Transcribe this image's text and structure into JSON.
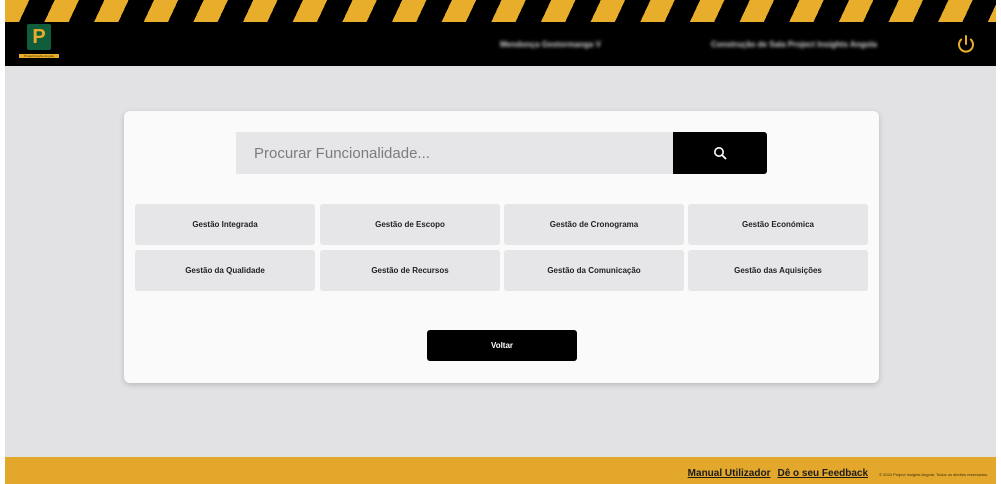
{
  "header": {
    "logo_caption": "ProjectInsights Angola",
    "project_name": "Mendonça Gestormanga V",
    "user_name": "Construção de Sala Project Insights Angola",
    "power_icon": "power-icon"
  },
  "search": {
    "placeholder": "Procurar Funcionalidade...",
    "button_icon": "search-icon"
  },
  "modules": [
    "Gestão Integrada",
    "Gestão de Escopo",
    "Gestão de Cronograma",
    "Gestão Económica",
    "Gestão da Qualidade",
    "Gestão de Recursos",
    "Gestão da Comunicação",
    "Gestão das Aquisições"
  ],
  "back_label": "Voltar",
  "footer": {
    "manual": "Manual Utilizador",
    "feedback": "Dê o seu Feedback",
    "copyright": "© 2024 Project Insights Angola. Todos os direitos reservados."
  },
  "colors": {
    "accent": "#e2a72b",
    "header_bg": "#000000",
    "logo_green": "#0f5d3a"
  }
}
